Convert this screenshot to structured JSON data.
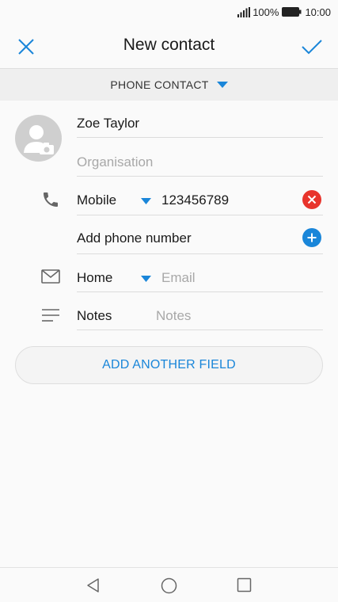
{
  "status_bar": {
    "battery": "100%",
    "time": "10:00",
    "icons": [
      "signal-icon",
      "battery-icon"
    ]
  },
  "app_bar": {
    "title": "New contact",
    "close_icon": "close-icon",
    "confirm_icon": "check-icon"
  },
  "account": {
    "label": "PHONE CONTACT",
    "icon": "caret-down-icon"
  },
  "contact": {
    "avatar_icon": "add-photo-avatar-icon",
    "name": "Zoe Taylor",
    "organisation_placeholder": "Organisation"
  },
  "phone": {
    "type": "Mobile",
    "number": "123456789",
    "add_label": "Add phone number",
    "icons": [
      "phone-icon",
      "remove-icon",
      "add-icon"
    ]
  },
  "email": {
    "type": "Home",
    "placeholder": "Email",
    "icon": "email-icon"
  },
  "notes": {
    "label": "Notes",
    "placeholder": "Notes",
    "icon": "notes-icon"
  },
  "add_field": {
    "label": "ADD ANOTHER FIELD"
  },
  "nav_bar": {
    "icons": [
      "back-icon",
      "home-icon",
      "recents-icon"
    ]
  },
  "colors": {
    "accent": "#1a86d9",
    "remove": "#e8342c",
    "avatar_bg": "#cfcfcf"
  }
}
